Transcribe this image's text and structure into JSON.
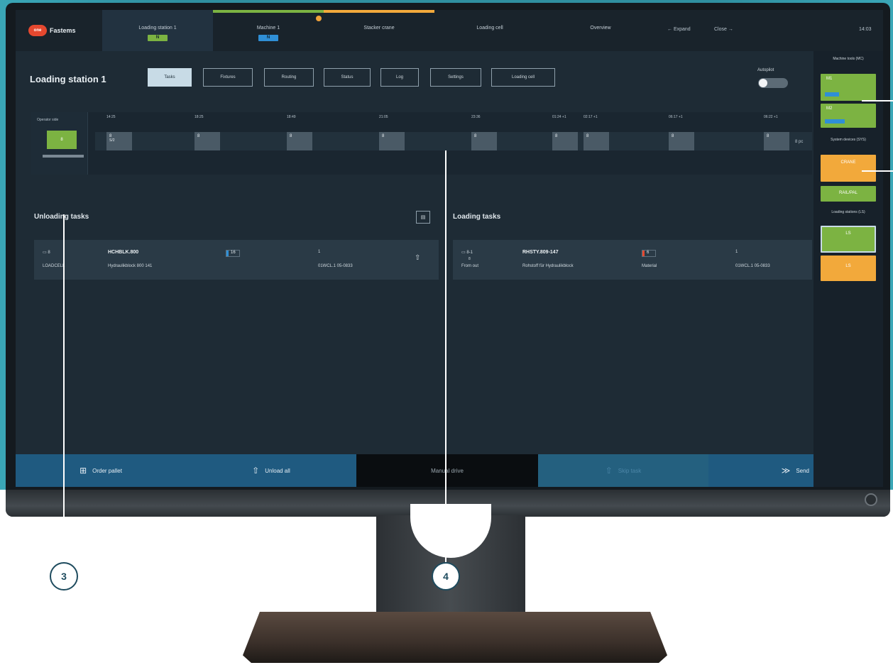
{
  "brand": {
    "logo_mark": "one",
    "name": "Fastems"
  },
  "nav": {
    "tabs": [
      {
        "label": "Loading station 1",
        "badge": "N",
        "badge_color": "#7cb342"
      },
      {
        "label": "Machine 1",
        "badge": "N",
        "badge_color": "#2f8fd6"
      },
      {
        "label": "Stacker crane",
        "badge": ""
      },
      {
        "label": "Loading cell",
        "badge": ""
      },
      {
        "label": "Overview",
        "badge": ""
      }
    ],
    "expand_label": "← Expand",
    "close_label": "Close →",
    "clock": "14:03"
  },
  "page": {
    "title": "Loading station 1",
    "tabs": [
      "Tasks",
      "Fixtures",
      "Routing",
      "Status",
      "Log",
      "Settings",
      "Loading cell"
    ],
    "active_tab": "Tasks",
    "autopilot_label": "Autopilot",
    "autopilot_on": false
  },
  "timeline": {
    "operator_side_label": "Operator side",
    "operator_pallet": "8",
    "times": [
      "14:25",
      "18:25",
      "18:49",
      "21:05",
      "23:36",
      "01:24 +1",
      "02:17 +1",
      "06:17 +1",
      "06:22 +1"
    ],
    "slots": [
      {
        "label": "8",
        "sub": "S/2"
      },
      {
        "label": "8"
      },
      {
        "label": "8"
      },
      {
        "label": "8"
      },
      {
        "label": "8"
      },
      {
        "label": "8"
      },
      {
        "label": "8"
      },
      {
        "label": "8"
      },
      {
        "label": "8"
      }
    ],
    "trailing_text": "8 pc"
  },
  "unloading": {
    "title": "Unloading tasks",
    "rows": [
      {
        "pallet": "8",
        "location": "LOADCELL",
        "code": "HCHBLK.800",
        "description": "Hydraulikblock 800 141",
        "qty": "16",
        "count": "1",
        "date": "01WCL.1 05-0833"
      }
    ]
  },
  "loading": {
    "title": "Loading tasks",
    "rows": [
      {
        "pallet": "8-1",
        "sub": "8",
        "location": "From out",
        "code": "RHSTY.809-147",
        "description": "Rohstoff für Hydraulikblock",
        "qty": "6",
        "status": "Material",
        "count": "1",
        "date": "01WCL.1 05-0833"
      }
    ]
  },
  "sidebar": {
    "machine_tools_label": "Machine tools (MC)",
    "machine_tiles": [
      "M1",
      "M2"
    ],
    "system_devices_label": "System devices (SYS)",
    "system_tiles": [
      "CRANE",
      "RAIL/PAL"
    ],
    "loading_stations_label": "Loading stations (LS)",
    "loading_tiles": [
      "LS",
      "LS"
    ]
  },
  "bottom_bar": {
    "order_pallet": "Order pallet",
    "unload_all": "Unload all",
    "manual_drive": "Manual drive",
    "disabled_action": "Skip task",
    "send": "Send"
  },
  "callouts": [
    "3",
    "4"
  ],
  "colors": {
    "green": "#7cb342",
    "orange": "#f2a93b",
    "blue": "#2f8fd6",
    "bottom_bar": "#1f5a80",
    "callout": "#1e4b5e"
  }
}
